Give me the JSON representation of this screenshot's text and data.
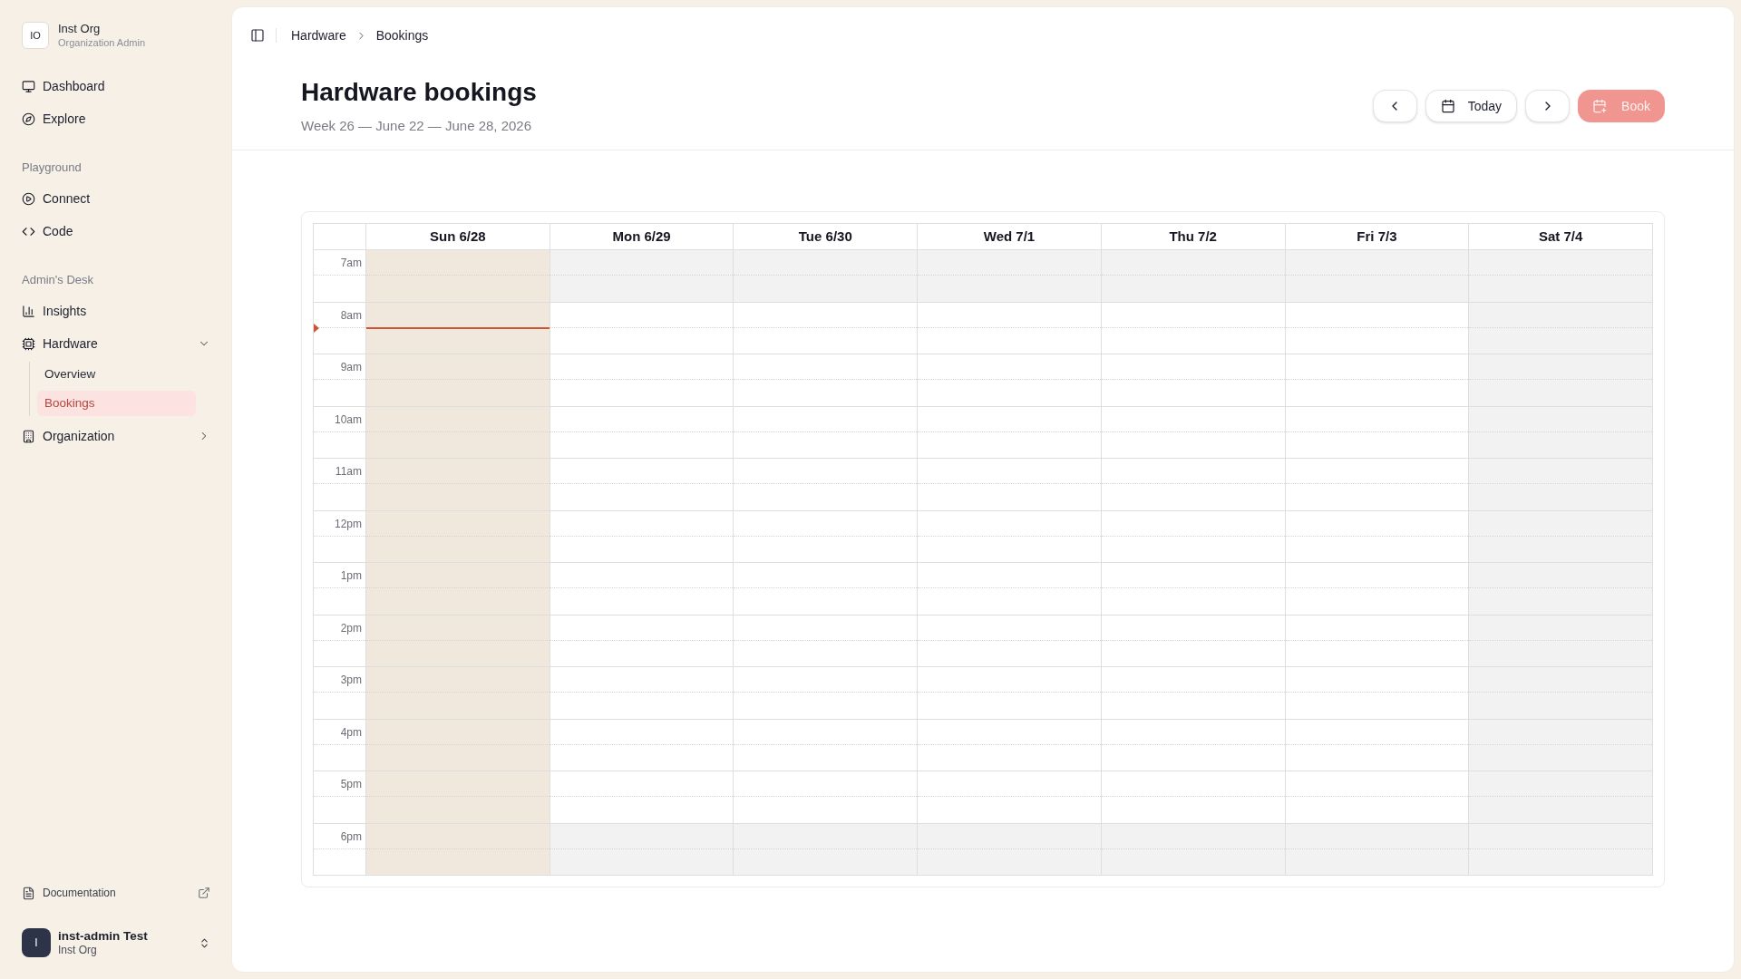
{
  "sidebar": {
    "org": {
      "initials": "IO",
      "name": "Inst Org",
      "role": "Organization Admin"
    },
    "nav": [
      {
        "label": "Dashboard",
        "selected": false
      },
      {
        "label": "Explore",
        "selected": false
      }
    ],
    "sections": [
      {
        "title": "Playground",
        "items": [
          {
            "kind": "link",
            "label": "Connect",
            "selected": false
          },
          {
            "kind": "link",
            "label": "Code",
            "selected": false
          }
        ]
      },
      {
        "title": "Admin's Desk",
        "items": [
          {
            "kind": "link",
            "label": "Insights",
            "selected": false
          },
          {
            "kind": "group",
            "label": "Hardware",
            "expanded": true,
            "children": [
              {
                "label": "Overview",
                "selected": false
              },
              {
                "label": "Bookings",
                "selected": true
              }
            ]
          },
          {
            "kind": "group",
            "label": "Organization",
            "expanded": false
          }
        ]
      }
    ],
    "documentation": {
      "label": "Documentation"
    },
    "user": {
      "initials": "I",
      "name": "inst-admin Test",
      "org": "Inst Org"
    }
  },
  "breadcrumb": [
    {
      "label": "Hardware"
    },
    {
      "label": "Bookings"
    }
  ],
  "header": {
    "title": "Hardware bookings",
    "subtitle": "Week 26 — June 22 — June 28, 2026"
  },
  "toolbar": {
    "today": {
      "label": "Today"
    },
    "book": {
      "label": "Book",
      "disabled": true
    }
  },
  "calendar": {
    "days": [
      {
        "label": "Sun 6/28",
        "kind": "today"
      },
      {
        "label": "Mon 6/29",
        "kind": "weekday"
      },
      {
        "label": "Tue 6/30",
        "kind": "weekday"
      },
      {
        "label": "Wed 7/1",
        "kind": "weekday"
      },
      {
        "label": "Thu 7/2",
        "kind": "weekday"
      },
      {
        "label": "Fri 7/3",
        "kind": "weekday"
      },
      {
        "label": "Sat 7/4",
        "kind": "weekend"
      }
    ],
    "hours": [
      {
        "label": "7am",
        "kind": "off_hours",
        "now": false
      },
      {
        "label": "8am",
        "kind": "work_hours",
        "now": true
      },
      {
        "label": "9am",
        "kind": "work_hours",
        "now": false
      },
      {
        "label": "10am",
        "kind": "work_hours",
        "now": false
      },
      {
        "label": "11am",
        "kind": "work_hours",
        "now": false
      },
      {
        "label": "12pm",
        "kind": "work_hours",
        "now": false
      },
      {
        "label": "1pm",
        "kind": "work_hours",
        "now": false
      },
      {
        "label": "2pm",
        "kind": "work_hours",
        "now": false
      },
      {
        "label": "3pm",
        "kind": "work_hours",
        "now": false
      },
      {
        "label": "4pm",
        "kind": "work_hours",
        "now": false
      },
      {
        "label": "5pm",
        "kind": "work_hours",
        "now": false
      },
      {
        "label": "6pm",
        "kind": "off_hours",
        "now": false
      }
    ]
  }
}
